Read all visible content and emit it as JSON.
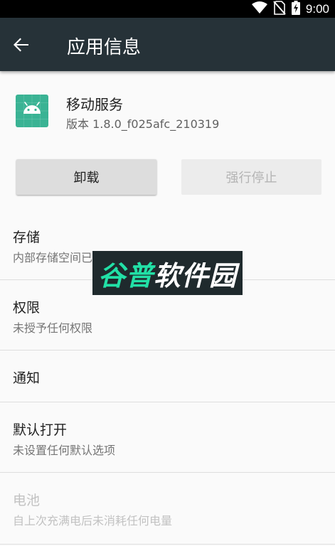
{
  "status_bar": {
    "time": "9:00",
    "icons": [
      "wifi-icon",
      "no-sim-icon",
      "battery-charging-icon"
    ]
  },
  "app_bar": {
    "title": "应用信息",
    "back_icon": "arrow-back-icon"
  },
  "app": {
    "name": "移动服务",
    "version": "版本 1.8.0_f025afc_210319",
    "icon": "android-icon",
    "icon_color": "#3ab394"
  },
  "buttons": {
    "uninstall": "卸载",
    "force_stop": "强行停止"
  },
  "settings": {
    "storage": {
      "title": "存储",
      "summary": "内部存储空间已使用 18.61 MB"
    },
    "permissions": {
      "title": "权限",
      "summary": "未授予任何权限"
    },
    "notifications": {
      "title": "通知"
    },
    "open_by_default": {
      "title": "默认打开",
      "summary": "未设置任何默认选项"
    },
    "battery": {
      "title": "电池",
      "summary": "自上次充满电后未消耗任何电量"
    }
  },
  "watermark": {
    "part1": "谷普",
    "part2": "软件园"
  },
  "colors": {
    "app_bar": "#263238",
    "status_bar": "#000000",
    "watermark_accent": "#22e0a6"
  }
}
